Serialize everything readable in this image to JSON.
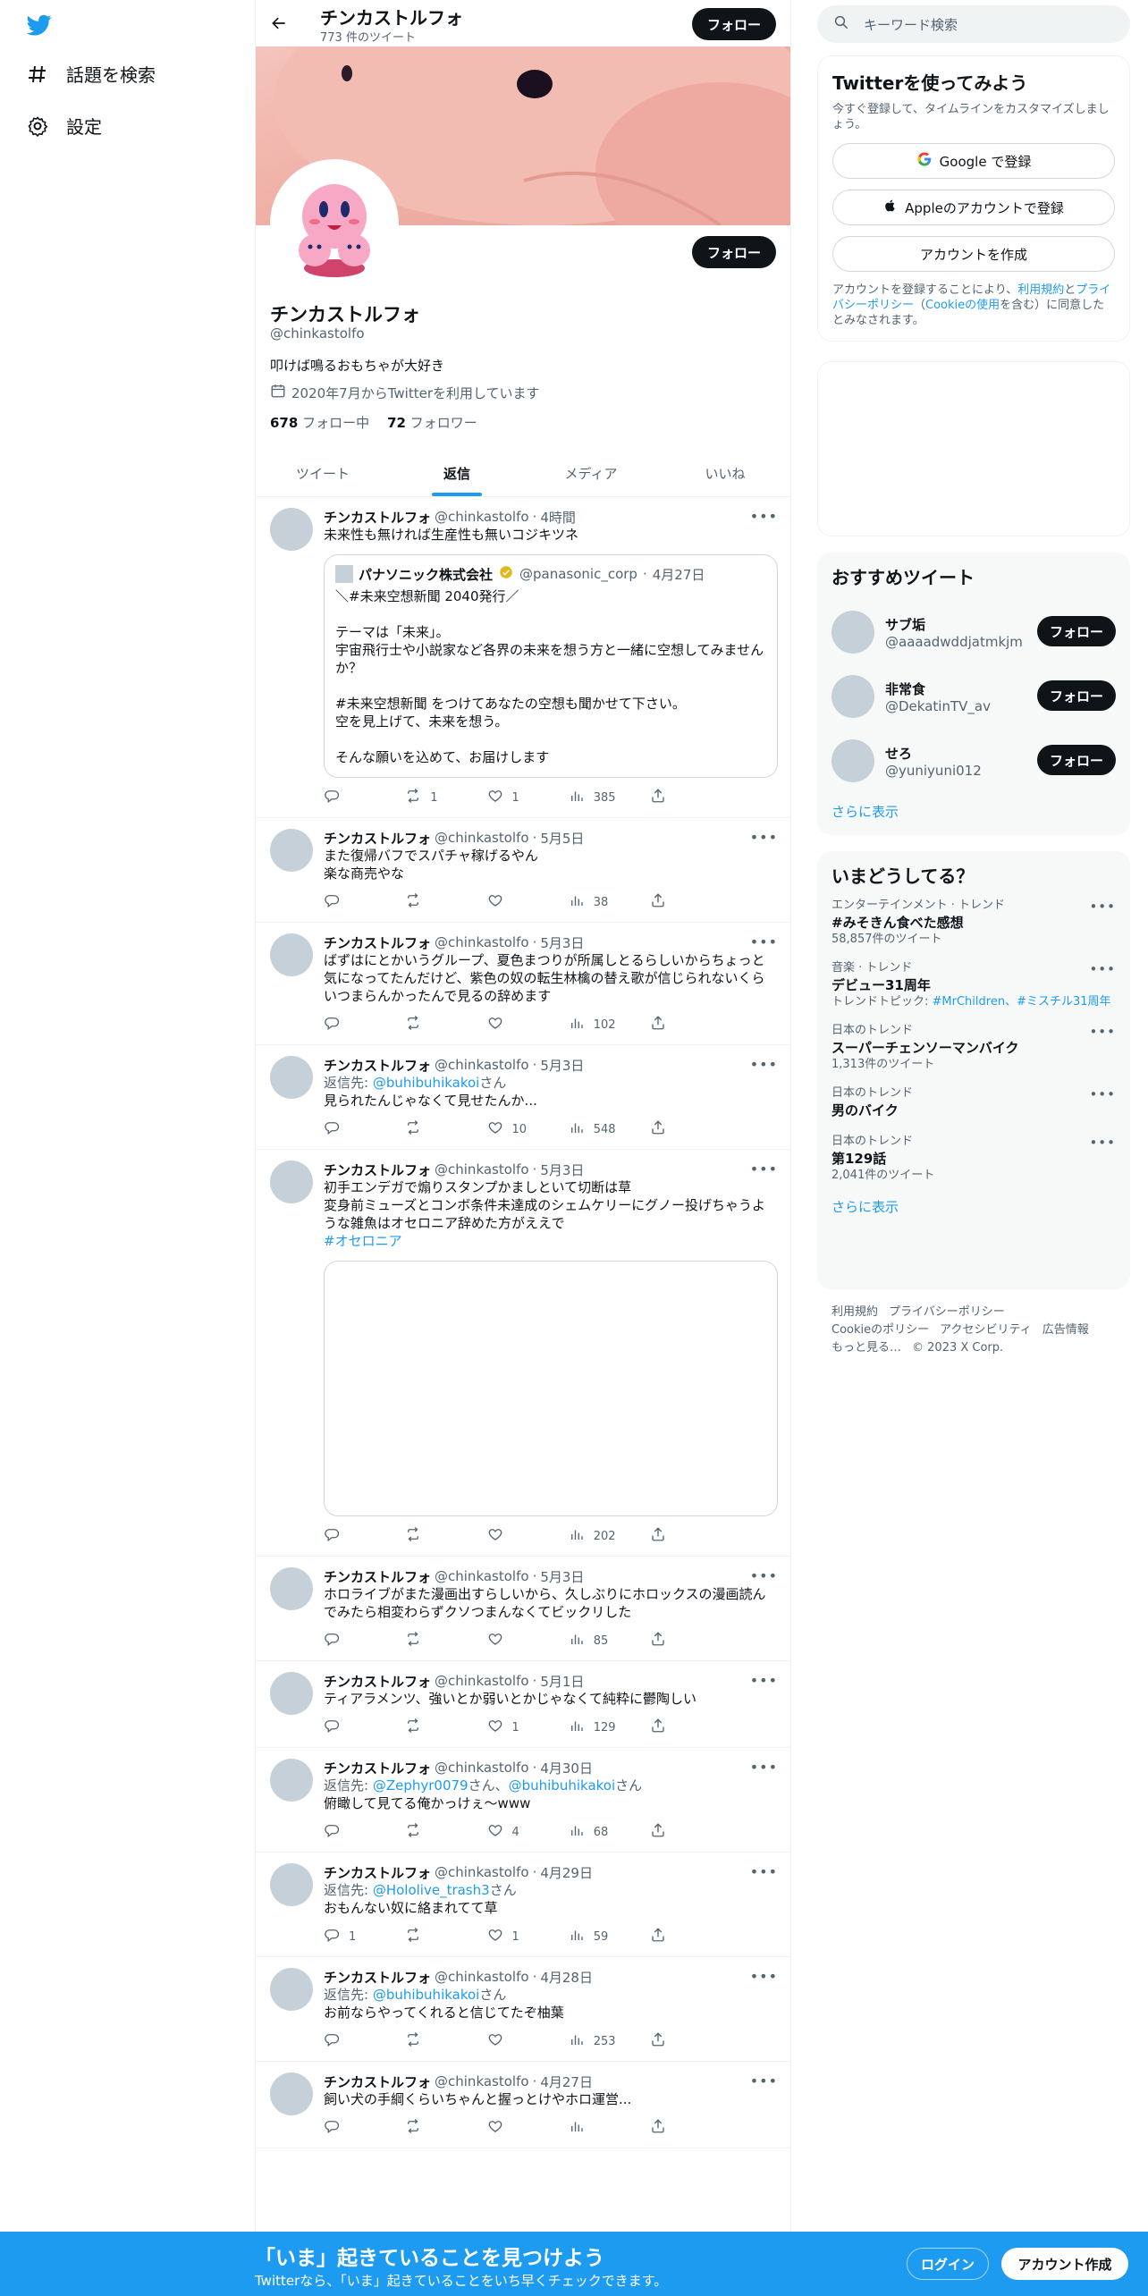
{
  "nav": {
    "items": [
      {
        "label": "話題を検索",
        "icon": "hashtag-icon"
      },
      {
        "label": "設定",
        "icon": "gear-icon"
      }
    ]
  },
  "header": {
    "name": "チンカストルフォ",
    "tweet_count": "773 件のツイート",
    "follow_label": "フォロー"
  },
  "profile": {
    "name": "チンカストルフォ",
    "handle": "@chinkastolfo",
    "bio": "叩けば鳴るおもちゃが大好き",
    "joined": "2020年7月からTwitterを利用しています",
    "following_count": "678",
    "following_label": "フォロー中",
    "followers_count": "72",
    "followers_label": "フォロワー",
    "follow_label": "フォロー"
  },
  "tabs": [
    "ツイート",
    "返信",
    "メディア",
    "いいね"
  ],
  "active_tab": "返信",
  "reply_prefix": "返信先: ",
  "tweets": [
    {
      "name": "チンカストルフォ",
      "handle": "@chinkastolfo",
      "time": "4時間",
      "text": "未来性も無ければ生産性も無いコジキツネ",
      "quote": {
        "name": "パナソニック株式会社",
        "handle": "@panasonic_corp",
        "time": "4月27日",
        "text": "＼#未来空想新聞 2040発行／\n\nテーマは「未来」。\n宇宙飛行士や小説家など各界の未来を想う方と一緒に空想してみませんか？\n\n#未来空想新聞 をつけてあなたの空想も聞かせて下さい。\n空を見上げて、未来を想う。\n\nそんな願いを込めて、お届けします"
      },
      "retweets": "1",
      "likes": "1",
      "views": "385"
    },
    {
      "name": "チンカストルフォ",
      "handle": "@chinkastolfo",
      "time": "5月5日",
      "text": "また復帰バフでスパチャ稼げるやん\n楽な商売やな",
      "retweets": "",
      "likes": "",
      "views": "38"
    },
    {
      "name": "チンカストルフォ",
      "handle": "@chinkastolfo",
      "time": "5月3日",
      "text": "ばずはにとかいうグループ、夏色まつりが所属しとるらしいからちょっと気になってたんだけど、紫色の奴の転生林檎の替え歌が信じられないくらいつまらんかったんで見るの辞めます",
      "retweets": "",
      "likes": "",
      "views": "102"
    },
    {
      "name": "チンカストルフォ",
      "handle": "@chinkastolfo",
      "time": "5月3日",
      "reply_to": "@buhibuhikakoi",
      "reply_suffix": "さん",
      "text": "見られたんじゃなくて見せたんか...",
      "retweets": "",
      "likes": "10",
      "views": "548"
    },
    {
      "name": "チンカストルフォ",
      "handle": "@chinkastolfo",
      "time": "5月3日",
      "text": "初手エンデガで煽りスタンプかましといて切断は草\n変身前ミューズとコンボ条件未達成のシェムケリーにグノー投げちゃうような雑魚はオセロニア辞めた方がええで",
      "hashtag": "#オセロニア",
      "media": true,
      "retweets": "",
      "likes": "",
      "views": "202"
    },
    {
      "name": "チンカストルフォ",
      "handle": "@chinkastolfo",
      "time": "5月3日",
      "text": "ホロライブがまた漫画出すらしいから、久しぶりにホロックスの漫画読んでみたら相変わらずクソつまんなくてビックリした",
      "retweets": "",
      "likes": "",
      "views": "85"
    },
    {
      "name": "チンカストルフォ",
      "handle": "@chinkastolfo",
      "time": "5月1日",
      "text": "ティアラメンツ、強いとか弱いとかじゃなくて純粋に鬱陶しい",
      "retweets": "",
      "likes": "1",
      "views": "129"
    },
    {
      "name": "チンカストルフォ",
      "handle": "@chinkastolfo",
      "time": "4月30日",
      "reply_to": "@Zephyr0079",
      "reply_mid": "さん、",
      "reply_to2": "@buhibuhikakoi",
      "reply_suffix": "さん",
      "text": "俯瞰して見てる俺かっけぇ〜www",
      "retweets": "",
      "likes": "4",
      "views": "68"
    },
    {
      "name": "チンカストルフォ",
      "handle": "@chinkastolfo",
      "time": "4月29日",
      "reply_to": "@Hololive_trash3",
      "reply_suffix": "さん",
      "text": "おもんない奴に絡まれてて草",
      "replies": "1",
      "retweets": "",
      "likes": "1",
      "views": "59"
    },
    {
      "name": "チンカストルフォ",
      "handle": "@chinkastolfo",
      "time": "4月28日",
      "reply_to": "@buhibuhikakoi",
      "reply_suffix": "さん",
      "text": "お前ならやってくれると信じてたぞ柚葉",
      "retweets": "",
      "likes": "",
      "views": "253"
    },
    {
      "name": "チンカストルフォ",
      "handle": "@chinkastolfo",
      "time": "4月27日",
      "text": "飼い犬の手綱くらいちゃんと握っとけやホロ運営...",
      "retweets": "",
      "likes": "",
      "views": ""
    }
  ],
  "search": {
    "placeholder": "キーワード検索"
  },
  "signup": {
    "title": "Twitterを使ってみよう",
    "subtitle": "今すぐ登録して、タイムラインをカスタマイズしましょう。",
    "google": "Google で登録",
    "apple": "Appleのアカウントで登録",
    "create": "アカウントを作成",
    "terms_a": "アカウントを登録することにより、",
    "terms_link1": "利用規約",
    "terms_b": "と",
    "terms_link2": "プライバシーポリシー",
    "terms_c": "（",
    "terms_link3": "Cookieの使用",
    "terms_d": "を含む）に同意したとみなされます。"
  },
  "recommended": {
    "title": "おすすめツイート",
    "follow_label": "フォロー",
    "users": [
      {
        "name": "サブ垢",
        "handle": "@aaaadwddjatmkjm"
      },
      {
        "name": "非常食",
        "handle": "@DekatinTV_av"
      },
      {
        "name": "せろ",
        "handle": "@yuniyuni012"
      }
    ],
    "more": "さらに表示"
  },
  "trends": {
    "title": "いまどうしてる？",
    "items": [
      {
        "category": "エンターテインメント · トレンド",
        "name": "#みそきん食べた感想",
        "meta": "58,857件のツイート"
      },
      {
        "category": "音楽 · トレンド",
        "name": "デビュー31周年",
        "meta_prefix": "トレンドトピック: ",
        "meta_link": "#MrChildren、#ミスチル31周年"
      },
      {
        "category": "日本のトレンド",
        "name": "スーパーチェンソーマンバイク",
        "meta": "1,313件のツイート"
      },
      {
        "category": "日本のトレンド",
        "name": "男のバイク",
        "meta": ""
      },
      {
        "category": "日本のトレンド",
        "name": "第129話",
        "meta": "2,041件のツイート"
      }
    ],
    "more": "さらに表示"
  },
  "footer": {
    "links": [
      "利用規約",
      "プライバシーポリシー",
      "Cookieのポリシー",
      "アクセシビリティ",
      "広告情報",
      "もっと見る…",
      "© 2023 X Corp."
    ]
  },
  "bottombar": {
    "title": "「いま」起きていることを見つけよう",
    "subtitle": "Twitterなら、「いま」起きていることをいち早くチェックできます。",
    "login": "ログイン",
    "signup": "アカウント作成"
  },
  "colors": {
    "accent": "#1d9bf0",
    "text": "#0f1419",
    "muted": "#536471",
    "banner": "#f0b0a6"
  }
}
